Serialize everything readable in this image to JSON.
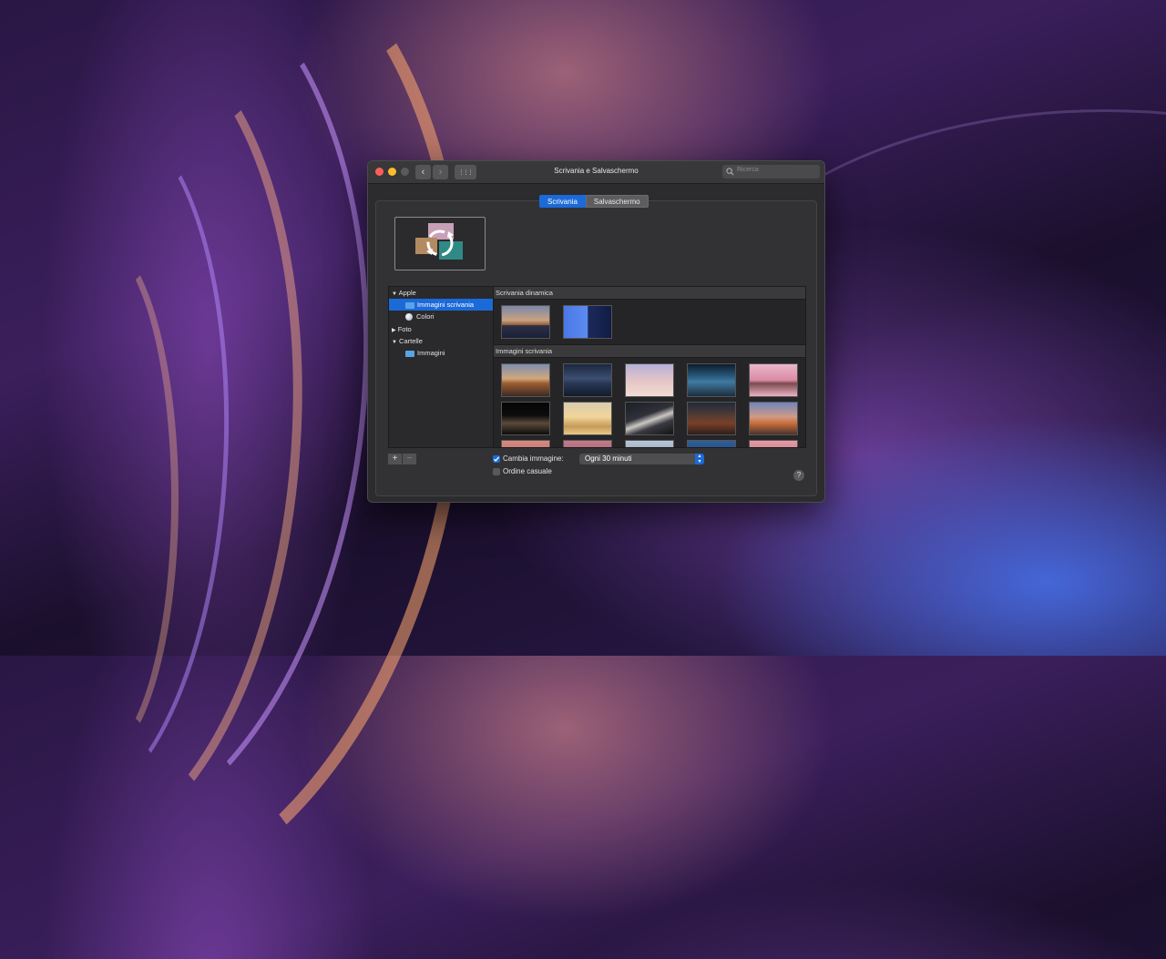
{
  "window": {
    "title": "Scrivania e Salvaschermo",
    "search_placeholder": "Ricerca",
    "nav": {
      "back": "‹",
      "forward": "›",
      "grid": "⋮⋮⋮"
    }
  },
  "tabs": [
    {
      "label": "Scrivania",
      "active": true
    },
    {
      "label": "Salvaschermo",
      "active": false
    }
  ],
  "sidebar": {
    "items": [
      {
        "label": "Apple",
        "type": "group",
        "expanded": true
      },
      {
        "label": "Immagini scrivania",
        "type": "folder",
        "selected": true
      },
      {
        "label": "Colori",
        "type": "colors"
      },
      {
        "label": "Foto",
        "type": "group",
        "expanded": false
      },
      {
        "label": "Cartelle",
        "type": "group",
        "expanded": true
      },
      {
        "label": "Immagini",
        "type": "folder"
      }
    ]
  },
  "gallery": {
    "section_dynamic": "Scrivania dinamica",
    "section_desktop": "Immagini scrivania"
  },
  "controls": {
    "add_label": "+",
    "remove_label": "−",
    "change_picture_label": "Cambia immagine:",
    "change_picture_checked": true,
    "interval_value": "Ogni 30 minuti",
    "random_order_label": "Ordine casuale",
    "random_order_checked": false,
    "help_label": "?"
  },
  "colors": {
    "accent": "#1b6ad8",
    "close": "#ff5f57",
    "minimize": "#febc2e",
    "disabled": "#5a5a5c"
  }
}
